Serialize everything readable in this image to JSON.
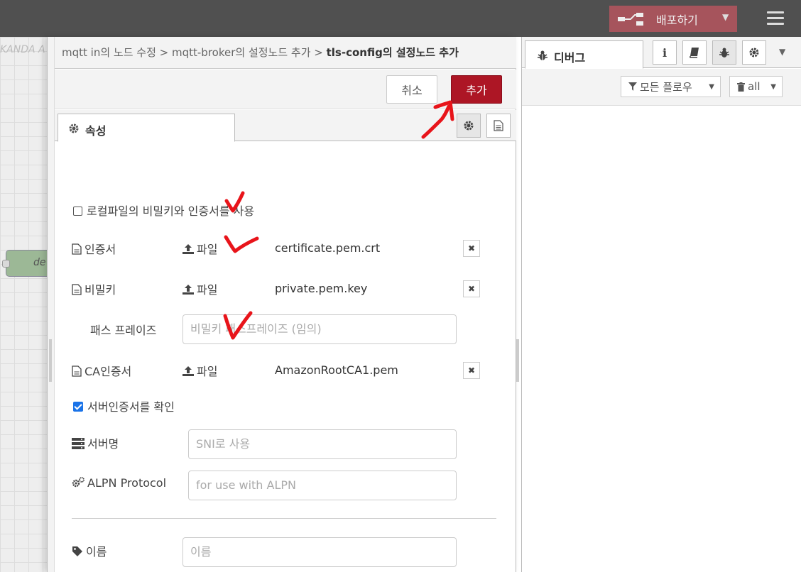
{
  "header": {
    "deploy_label": "배포하기"
  },
  "workspace": {
    "tab_fragment": "KANDA A",
    "node_fragment": "de"
  },
  "tray": {
    "breadcrumb": {
      "part1": "mqtt in의 노드 수정",
      "sep1": " > ",
      "part2": "mqtt-broker의 설정노드 추가",
      "sep2": " > ",
      "current": "tls-config의 설정노드 추가"
    },
    "cancel_label": "취소",
    "add_label": "추가",
    "tab_properties": "속성"
  },
  "form": {
    "use_local_files_label": "로컬파일의 비밀키와 인증서를 사용",
    "certificate": {
      "label": "인증서",
      "upload_label": "파일",
      "filename": "certificate.pem.crt"
    },
    "private_key": {
      "label": "비밀키",
      "upload_label": "파일",
      "filename": "private.pem.key"
    },
    "passphrase": {
      "label": "패스 프레이즈",
      "placeholder": "비밀키 패스프레이즈 (임의)"
    },
    "ca_cert": {
      "label": "CA인증서",
      "upload_label": "파일",
      "filename": "AmazonRootCA1.pem"
    },
    "verify_server_label": "서버인증서를 확인",
    "server_name": {
      "label": "서버명",
      "placeholder": "SNI로 사용"
    },
    "alpn": {
      "label": "ALPN Protocol",
      "placeholder": "for use with ALPN"
    },
    "name": {
      "label": "이름",
      "placeholder": "이름"
    }
  },
  "sidebar": {
    "debug_tab_label": "디버그",
    "filter_label": "모든 플로우",
    "clear_label": "all"
  },
  "colors": {
    "header_bg": "#505050",
    "deploy_bg": "#a6545c",
    "primary_button": "#ad1625",
    "annotation_red": "#e8141a",
    "checkbox_blue": "#1a73e8"
  }
}
